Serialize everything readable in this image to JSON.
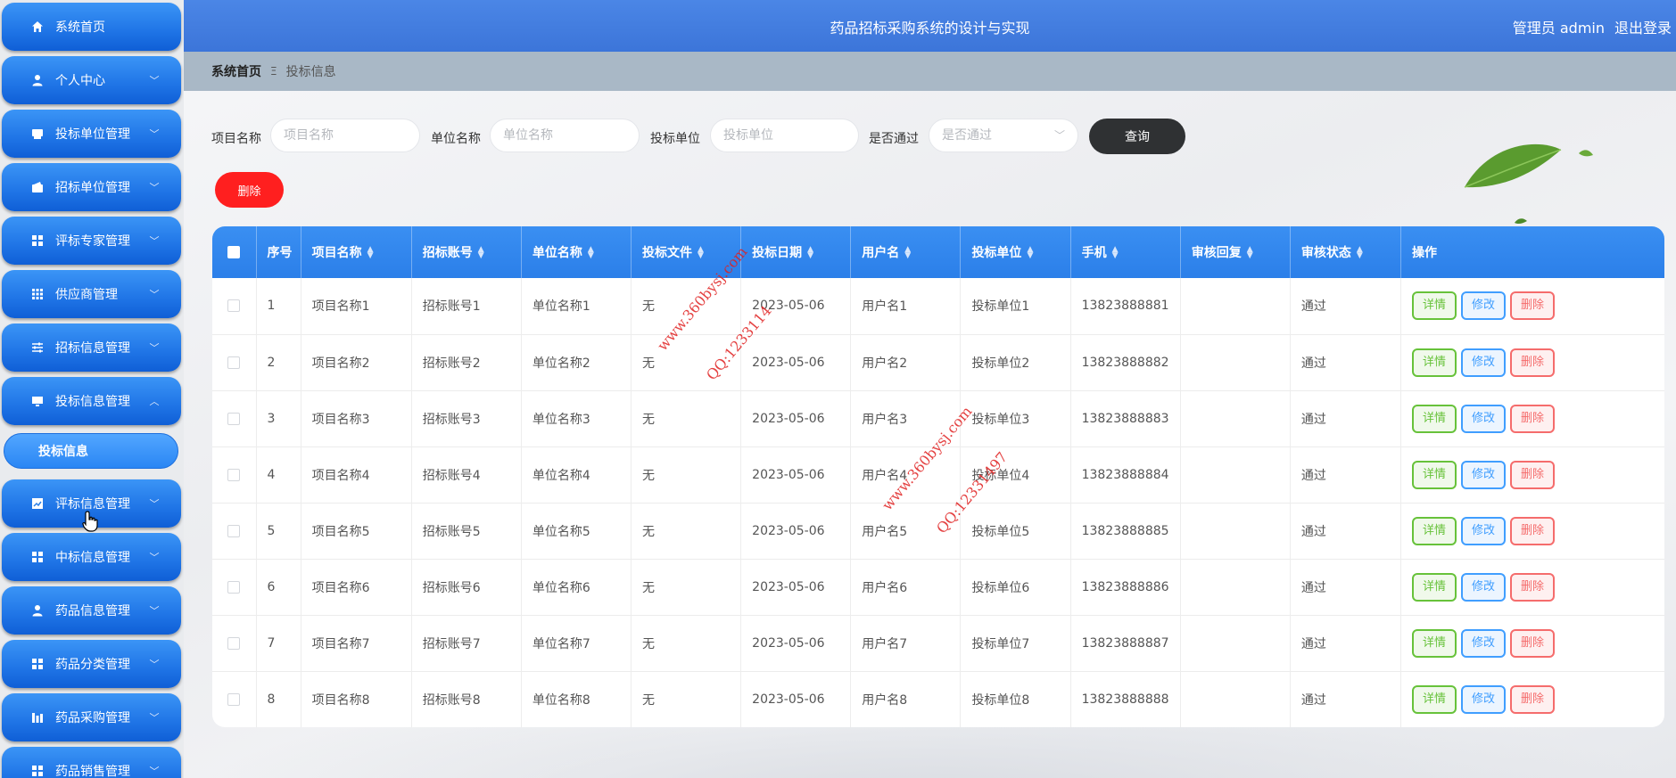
{
  "app": {
    "title": "药品招标采购系统的设计与实现"
  },
  "header": {
    "user": "管理员 admin",
    "logout": "退出登录"
  },
  "sidebar": {
    "items": [
      {
        "label": "系统首页",
        "icon": "home-icon",
        "chevron": ""
      },
      {
        "label": "个人中心",
        "icon": "user-icon",
        "chevron": "﹀"
      },
      {
        "label": "投标单位管理",
        "icon": "printer-icon",
        "chevron": "﹀"
      },
      {
        "label": "招标单位管理",
        "icon": "wallet-icon",
        "chevron": "﹀"
      },
      {
        "label": "评标专家管理",
        "icon": "grid-icon",
        "chevron": "﹀"
      },
      {
        "label": "供应商管理",
        "icon": "apps-icon",
        "chevron": "﹀"
      },
      {
        "label": "招标信息管理",
        "icon": "sliders-icon",
        "chevron": "﹀"
      },
      {
        "label": "投标信息管理",
        "icon": "monitor-icon",
        "chevron": "︿"
      },
      {
        "label": "评标信息管理",
        "icon": "chart-icon",
        "chevron": "﹀"
      },
      {
        "label": "中标信息管理",
        "icon": "grid-icon",
        "chevron": "﹀"
      },
      {
        "label": "药品信息管理",
        "icon": "user-icon",
        "chevron": "﹀"
      },
      {
        "label": "药品分类管理",
        "icon": "grid-icon",
        "chevron": "﹀"
      },
      {
        "label": "药品采购管理",
        "icon": "bars-icon",
        "chevron": "﹀"
      },
      {
        "label": "药品销售管理",
        "icon": "grid-icon",
        "chevron": "﹀"
      }
    ],
    "submenu": {
      "label": "投标信息"
    }
  },
  "breadcrumb": {
    "home": "系统首页",
    "separator": "Ξ",
    "current": "投标信息"
  },
  "search": {
    "project_label": "项目名称",
    "project_placeholder": "项目名称",
    "unit_label": "单位名称",
    "unit_placeholder": "单位名称",
    "bidder_label": "投标单位",
    "bidder_placeholder": "投标单位",
    "pass_label": "是否通过",
    "pass_placeholder": "是否通过",
    "query_button": "查询"
  },
  "actions": {
    "delete_batch": "删除"
  },
  "table": {
    "columns": [
      "序号",
      "项目名称",
      "招标账号",
      "单位名称",
      "投标文件",
      "投标日期",
      "用户名",
      "投标单位",
      "手机",
      "审核回复",
      "审核状态",
      "操作"
    ],
    "sortable": [
      false,
      true,
      true,
      true,
      true,
      true,
      true,
      true,
      true,
      true,
      true,
      false
    ],
    "rows": [
      [
        "1",
        "项目名称1",
        "招标账号1",
        "单位名称1",
        "无",
        "2023-05-06",
        "用户名1",
        "投标单位1",
        "13823888881",
        "",
        "通过"
      ],
      [
        "2",
        "项目名称2",
        "招标账号2",
        "单位名称2",
        "无",
        "2023-05-06",
        "用户名2",
        "投标单位2",
        "13823888882",
        "",
        "通过"
      ],
      [
        "3",
        "项目名称3",
        "招标账号3",
        "单位名称3",
        "无",
        "2023-05-06",
        "用户名3",
        "投标单位3",
        "13823888883",
        "",
        "通过"
      ],
      [
        "4",
        "项目名称4",
        "招标账号4",
        "单位名称4",
        "无",
        "2023-05-06",
        "用户名4",
        "投标单位4",
        "13823888884",
        "",
        "通过"
      ],
      [
        "5",
        "项目名称5",
        "招标账号5",
        "单位名称5",
        "无",
        "2023-05-06",
        "用户名5",
        "投标单位5",
        "13823888885",
        "",
        "通过"
      ],
      [
        "6",
        "项目名称6",
        "招标账号6",
        "单位名称6",
        "无",
        "2023-05-06",
        "用户名6",
        "投标单位6",
        "13823888886",
        "",
        "通过"
      ],
      [
        "7",
        "项目名称7",
        "招标账号7",
        "单位名称7",
        "无",
        "2023-05-06",
        "用户名7",
        "投标单位7",
        "13823888887",
        "",
        "通过"
      ],
      [
        "8",
        "项目名称8",
        "招标账号8",
        "单位名称8",
        "无",
        "2023-05-06",
        "用户名8",
        "投标单位8",
        "13823888888",
        "",
        "通过"
      ]
    ],
    "row_actions": {
      "detail": "详情",
      "edit": "修改",
      "delete": "删除"
    }
  },
  "watermarks": [
    "www.360bysj.com",
    "QQ:1233114",
    "www.360bysj.com",
    "QQ:12331497"
  ],
  "colors": {
    "primary": "#2b7fe9",
    "header": "#4b86e6",
    "danger": "#ff1f1f",
    "query": "#2f3133"
  }
}
